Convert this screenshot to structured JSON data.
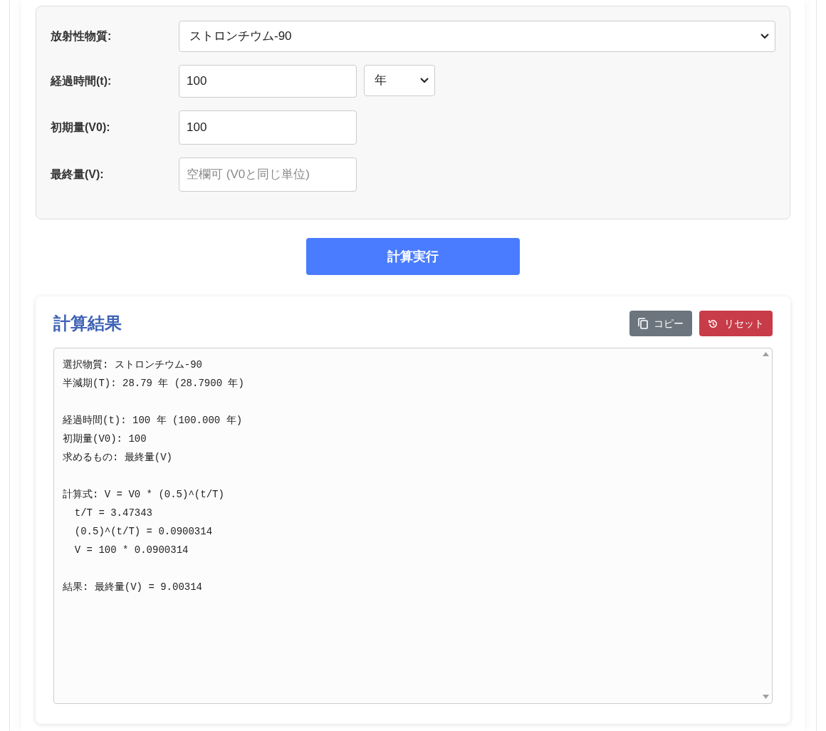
{
  "form": {
    "fields": [
      {
        "kind": "select",
        "label": "放射性物質:",
        "value": "ストロンチウム-90"
      },
      {
        "kind": "input_unit",
        "label": "経過時間(t):",
        "value": "100",
        "unit": "年"
      },
      {
        "kind": "input",
        "label": "初期量(V0):",
        "value": "100"
      },
      {
        "kind": "input",
        "label": "最終量(V):",
        "placeholder": "空欄可 (V0と同じ単位)"
      }
    ]
  },
  "calculate_button": "計算実行",
  "result": {
    "title": "計算結果",
    "copy_button": "コピー",
    "reset_button": "リセット",
    "groups": [
      [
        "選択物質: ストロンチウム-90",
        "半減期(T): 28.79 年 (28.7900 年)"
      ],
      [
        "経過時間(t): 100 年 (100.000 年)",
        "初期量(V0): 100",
        "求めるもの: 最終量(V)"
      ],
      [
        "計算式: V = V0 * (0.5)^(t/T)",
        "  t/T = 3.47343",
        "  (0.5)^(t/T) = 0.0900314",
        "  V = 100 * 0.0900314"
      ],
      [
        "結果: 最終量(V) = 9.00314"
      ]
    ]
  }
}
